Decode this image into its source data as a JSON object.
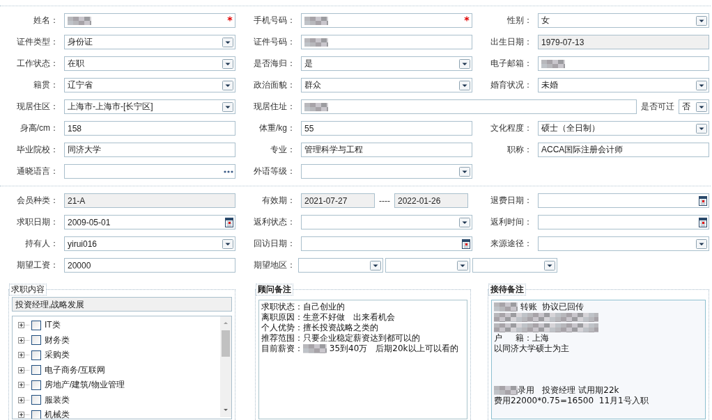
{
  "section_1": {
    "rows": [
      [
        {
          "label": "姓名：",
          "kind": "text",
          "blurred": true,
          "required": true
        },
        {
          "label": "手机号码：",
          "kind": "text",
          "blurred": true,
          "required": true
        },
        {
          "label": "性别：",
          "kind": "select",
          "value": "女"
        }
      ],
      [
        {
          "label": "证件类型：",
          "kind": "select",
          "value": "身份证"
        },
        {
          "label": "证件号码：",
          "kind": "text",
          "blurred": true
        },
        {
          "label": "出生日期：",
          "kind": "text",
          "readonly": true,
          "value": "1979-07-13"
        }
      ],
      [
        {
          "label": "工作状态：",
          "kind": "select",
          "value": "在职"
        },
        {
          "label": "是否海归：",
          "kind": "select",
          "value": "是"
        },
        {
          "label": "电子邮箱：",
          "kind": "text",
          "blurred": true
        }
      ],
      [
        {
          "label": "籍贯：",
          "kind": "select",
          "value": "辽宁省"
        },
        {
          "label": "政治面貌：",
          "kind": "select",
          "value": "群众"
        },
        {
          "label": "婚育状况：",
          "kind": "select",
          "value": "未婚"
        }
      ],
      [
        {
          "label": "现居住区：",
          "kind": "select",
          "value": "上海市-上海市-[长宁区]"
        },
        {
          "label": "现居住址：",
          "kind": "text",
          "blurred": true,
          "inline_after": {
            "label": "是否可迁",
            "kind": "select",
            "value": "否"
          }
        }
      ],
      [
        {
          "label": "身高/cm：",
          "kind": "text",
          "value": "158"
        },
        {
          "label": "体重/kg：",
          "kind": "text",
          "value": "55"
        },
        {
          "label": "文化程度：",
          "kind": "select",
          "value": "硕士（全日制）"
        }
      ],
      [
        {
          "label": "毕业院校：",
          "kind": "text",
          "value": "同济大学"
        },
        {
          "label": "专业：",
          "kind": "text",
          "value": "管理科学与工程"
        },
        {
          "label": "职称：",
          "kind": "text",
          "value": "ACCA国际注册会计师"
        }
      ],
      [
        {
          "label": "通晓语言：",
          "kind": "lookup"
        },
        {
          "label": "外语等级：",
          "kind": "select"
        }
      ]
    ]
  },
  "section_2": {
    "rows": [
      [
        {
          "label": "会员种类：",
          "kind": "text",
          "readonly": true,
          "value": "21-A"
        },
        {
          "label": "有效期：",
          "kind": "range",
          "separator": "----",
          "from": {
            "readonly": true,
            "value": "2021-07-27"
          },
          "to": {
            "readonly": true,
            "value": "2022-01-26"
          }
        },
        {
          "label": "退费日期：",
          "kind": "date"
        }
      ],
      [
        {
          "label": "求职日期：",
          "kind": "date",
          "value": "2009-05-01"
        },
        {
          "label": "返利状态：",
          "kind": "select"
        },
        {
          "label": "返利时间：",
          "kind": "date"
        }
      ],
      [
        {
          "label": "持有人：",
          "kind": "select",
          "value": "yirui016"
        },
        {
          "label": "回访日期：",
          "kind": "date"
        },
        {
          "label": "来源途径：",
          "kind": "select"
        }
      ],
      [
        {
          "label": "期望工资：",
          "kind": "text",
          "value": "20000"
        },
        {
          "label": "期望地区：",
          "kind": "multi",
          "parts": [
            {
              "kind": "select"
            },
            {
              "kind": "select"
            },
            {
              "kind": "select"
            }
          ]
        }
      ]
    ]
  },
  "panels": [
    {
      "kind": "tree",
      "title": "求职内容",
      "bold": false,
      "summary": {
        "value": "投资经理,战略发展",
        "readonly": true
      },
      "items": [
        {
          "label": "IT类",
          "checked": false,
          "expanded": false
        },
        {
          "label": "财务类",
          "checked": false,
          "expanded": false
        },
        {
          "label": "采购类",
          "checked": false,
          "expanded": false
        },
        {
          "label": "电子商务/互联网",
          "checked": false,
          "expanded": false
        },
        {
          "label": "房地产/建筑/物业管理",
          "checked": false,
          "expanded": false
        },
        {
          "label": "服装类",
          "checked": false,
          "expanded": false
        },
        {
          "label": "机械类",
          "checked": false,
          "expanded": false
        }
      ]
    },
    {
      "kind": "notes",
      "title": "顾问备注",
      "bold": true,
      "tinted": false,
      "lines": [
        {
          "segments": [
            {
              "kind": "text",
              "text": "求职状态：自己创业的"
            }
          ]
        },
        {
          "segments": [
            {
              "kind": "text",
              "text": "离职原因：生意不好做　出来看机会"
            }
          ]
        },
        {
          "segments": [
            {
              "kind": "text",
              "text": "个人优势：擅长投资战略之类的"
            }
          ]
        },
        {
          "segments": [
            {
              "kind": "text",
              "text": "推荐范围：只要企业稳定薪资达到都可以的"
            }
          ]
        },
        {
          "segments": [
            {
              "kind": "text",
              "text": "目前薪资："
            },
            {
              "kind": "blur",
              "long": false
            },
            {
              "kind": "text",
              "text": " 35到40万　后期20k以上可以看的"
            }
          ]
        }
      ]
    },
    {
      "kind": "notes",
      "title": "接待备注",
      "bold": true,
      "tinted": true,
      "lines": [
        {
          "segments": [
            {
              "kind": "blur",
              "long": false
            },
            {
              "kind": "text",
              "text": " 转账  协议已回传"
            }
          ]
        },
        {
          "segments": [
            {
              "kind": "blur",
              "long": true
            }
          ]
        },
        {
          "segments": [
            {
              "kind": "blur",
              "long": true
            }
          ]
        },
        {
          "segments": [
            {
              "kind": "text",
              "text": "户     籍：上海"
            }
          ]
        },
        {
          "segments": [
            {
              "kind": "text",
              "text": "以同济大学硕士为主"
            }
          ]
        },
        {
          "gap_before": true,
          "segments": [
            {
              "kind": "blur",
              "long": false
            },
            {
              "kind": "text",
              "text": "录用   投资经理 试用期22k"
            }
          ]
        },
        {
          "segments": [
            {
              "kind": "text",
              "text": "费用22000*0.75=16500  11月1号入职"
            }
          ]
        }
      ]
    }
  ]
}
